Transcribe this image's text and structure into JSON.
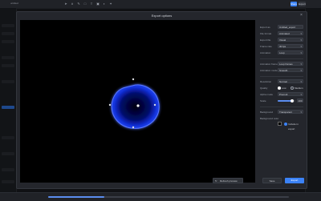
{
  "app": {
    "file_name": "untitled",
    "share_label": "Share",
    "export_label": "Export",
    "toolbar_icons": [
      "pointer-icon",
      "frame-icon",
      "pen-icon",
      "shape-icon",
      "text-icon",
      "image-icon",
      "gradient-icon",
      "effects-icon"
    ]
  },
  "dialog": {
    "title": "Export options",
    "close_icon": "×",
    "settings": {
      "rows": [
        {
          "label": "Export as",
          "value": "Untitled_export"
        },
        {
          "label": "File format",
          "value": "Animated"
        },
        {
          "label": "Export file",
          "value": "Visual"
        },
        {
          "label": "Frame rate",
          "value": "30 fps"
        },
        {
          "label": "Animation",
          "value": "Loop"
        }
      ],
      "rows2": [
        {
          "label": "Animation frame",
          "value": "Loop frames"
        },
        {
          "label": "Animation mode",
          "value": "Smooth"
        }
      ],
      "resolution": {
        "label": "Resolution",
        "value": "Normal"
      },
      "quality": {
        "label": "Quality",
        "options": [
          "Low",
          "Medium"
        ],
        "selected": 0
      },
      "alpha_mode": {
        "label": "Alpha mode",
        "value": "Premult"
      },
      "scale": {
        "label": "Scale",
        "value": "100",
        "fraction": 0.8
      },
      "background": {
        "label": "Background",
        "value": "Transparent"
      },
      "background_color": {
        "label": "Background color",
        "checkbox_label": "Include in export",
        "color": "#000000"
      }
    },
    "refresh_label": "Refresh preview",
    "save_label": "Save",
    "export_label": "Export"
  },
  "colors": {
    "accent": "#3b82f6",
    "blob_blue": "#1f3cff",
    "preview_bg": "#000000"
  }
}
